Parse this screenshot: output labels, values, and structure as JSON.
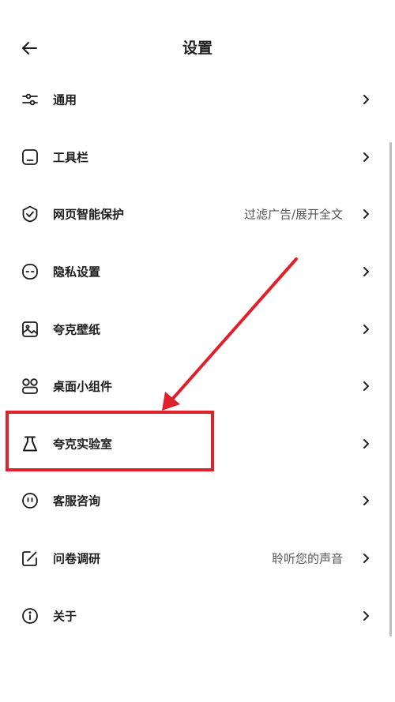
{
  "header": {
    "title": "设置",
    "back_icon": "arrow-left-icon"
  },
  "items": [
    {
      "label": "通用",
      "icon": "sliders-icon",
      "value": ""
    },
    {
      "label": "工具栏",
      "icon": "toolbar-icon",
      "value": ""
    },
    {
      "label": "网页智能保护",
      "icon": "shield-check-icon",
      "value": "过滤广告/展开全文"
    },
    {
      "label": "隐私设置",
      "icon": "privacy-mask-icon",
      "value": ""
    },
    {
      "label": "夸克壁纸",
      "icon": "wallpaper-icon",
      "value": ""
    },
    {
      "label": "桌面小组件",
      "icon": "widgets-icon",
      "value": ""
    },
    {
      "label": "夸克实验室",
      "icon": "flask-icon",
      "value": ""
    },
    {
      "label": "客服咨询",
      "icon": "support-face-icon",
      "value": ""
    },
    {
      "label": "问卷调研",
      "icon": "survey-edit-icon",
      "value": "聆听您的声音"
    },
    {
      "label": "关于",
      "icon": "info-icon",
      "value": ""
    }
  ],
  "colors": {
    "annotation": "#e0202a",
    "text": "#1c1c1c",
    "secondary_text": "#555555",
    "chevron": "#222222"
  }
}
